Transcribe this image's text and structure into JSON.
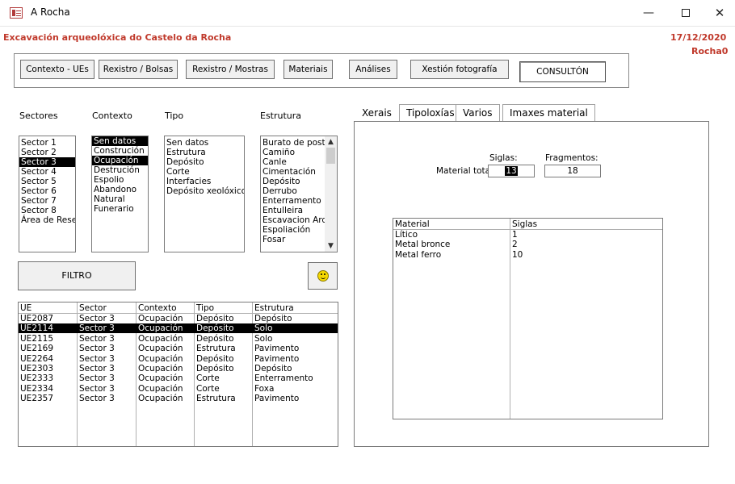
{
  "window": {
    "title": "A Rocha",
    "minimize_glyph": "—",
    "close_glyph": "✕"
  },
  "header": {
    "title": "Excavación arqueolóxica do Castelo da Rocha",
    "date": "17/12/2020",
    "user": "Rocha0"
  },
  "toolbar": {
    "buttons": [
      "Contexto - UEs",
      "Rexistro / Bolsas",
      "Rexistro / Mostras",
      "Materiais",
      "Análises",
      "Xestión fotografía",
      "CONSULTÓN"
    ]
  },
  "filters": {
    "sectores": {
      "label": "Sectores",
      "items": [
        "Sector 1",
        "Sector 2",
        "Sector 3",
        "Sector 4",
        "Sector 5",
        "Sector 6",
        "Sector 7",
        "Sector 8",
        "Área de Reser"
      ],
      "selected": [
        "Sector 3"
      ]
    },
    "contexto": {
      "label": "Contexto",
      "items": [
        "Sen datos",
        "Construción",
        "Ocupación",
        "Destrución",
        "Espolio",
        "Abandono",
        "Natural",
        "Funerario"
      ],
      "selected": [
        "Sen datos",
        "Ocupación"
      ]
    },
    "tipo": {
      "label": "Tipo",
      "items": [
        "Sen datos",
        "Estrutura",
        "Depósito",
        "Corte",
        "Interfacies",
        "Depósito xeolóxico"
      ],
      "selected": []
    },
    "estrutura": {
      "label": "Estrutura",
      "items": [
        "Burato de poste",
        "Camiño",
        "Canle",
        "Cimentación",
        "Depósito",
        "Derrubo",
        "Enterramento",
        "Entulleira",
        "Escavacion Arqu",
        "Espoliación",
        "Fosar"
      ],
      "selected": []
    },
    "filter_button": "FILTRO",
    "smiley_icon": "smiley-icon"
  },
  "results": {
    "columns": [
      "UE",
      "Sector",
      "Contexto",
      "Tipo",
      "Estrutura"
    ],
    "rows": [
      [
        "UE2087",
        "Sector 3",
        "Ocupación",
        "Depósito",
        "Depósito"
      ],
      [
        "UE2114",
        "Sector 3",
        "Ocupación",
        "Depósito",
        "Solo"
      ],
      [
        "UE2115",
        "Sector 3",
        "Ocupación",
        "Depósito",
        "Solo"
      ],
      [
        "UE2169",
        "Sector 3",
        "Ocupación",
        "Estrutura",
        "Pavimento"
      ],
      [
        "UE2264",
        "Sector 3",
        "Ocupación",
        "Depósito",
        "Pavimento"
      ],
      [
        "UE2303",
        "Sector 3",
        "Ocupación",
        "Depósito",
        "Depósito"
      ],
      [
        "UE2333",
        "Sector 3",
        "Ocupación",
        "Corte",
        "Enterramento"
      ],
      [
        "UE2334",
        "Sector 3",
        "Ocupación",
        "Corte",
        "Foxa"
      ],
      [
        "UE2357",
        "Sector 3",
        "Ocupación",
        "Estrutura",
        "Pavimento"
      ]
    ],
    "selected_row": 1
  },
  "tabs": {
    "items": [
      "Xerais",
      "Tipoloxías",
      "Varios",
      "Imaxes material"
    ],
    "active": 0
  },
  "xerais": {
    "siglas_label": "Siglas:",
    "fragmentos_label": "Fragmentos:",
    "material_total_label": "Material total:",
    "siglas_value": "13",
    "fragmentos_value": "18",
    "materials_table": {
      "columns": [
        "Material",
        "Siglas"
      ],
      "rows": [
        [
          "Lítico",
          "1"
        ],
        [
          "Metal bronce",
          "2"
        ],
        [
          "Metal ferro",
          "10"
        ]
      ]
    }
  },
  "colors": {
    "accent_red": "#c0392b",
    "selection": "#000000"
  }
}
